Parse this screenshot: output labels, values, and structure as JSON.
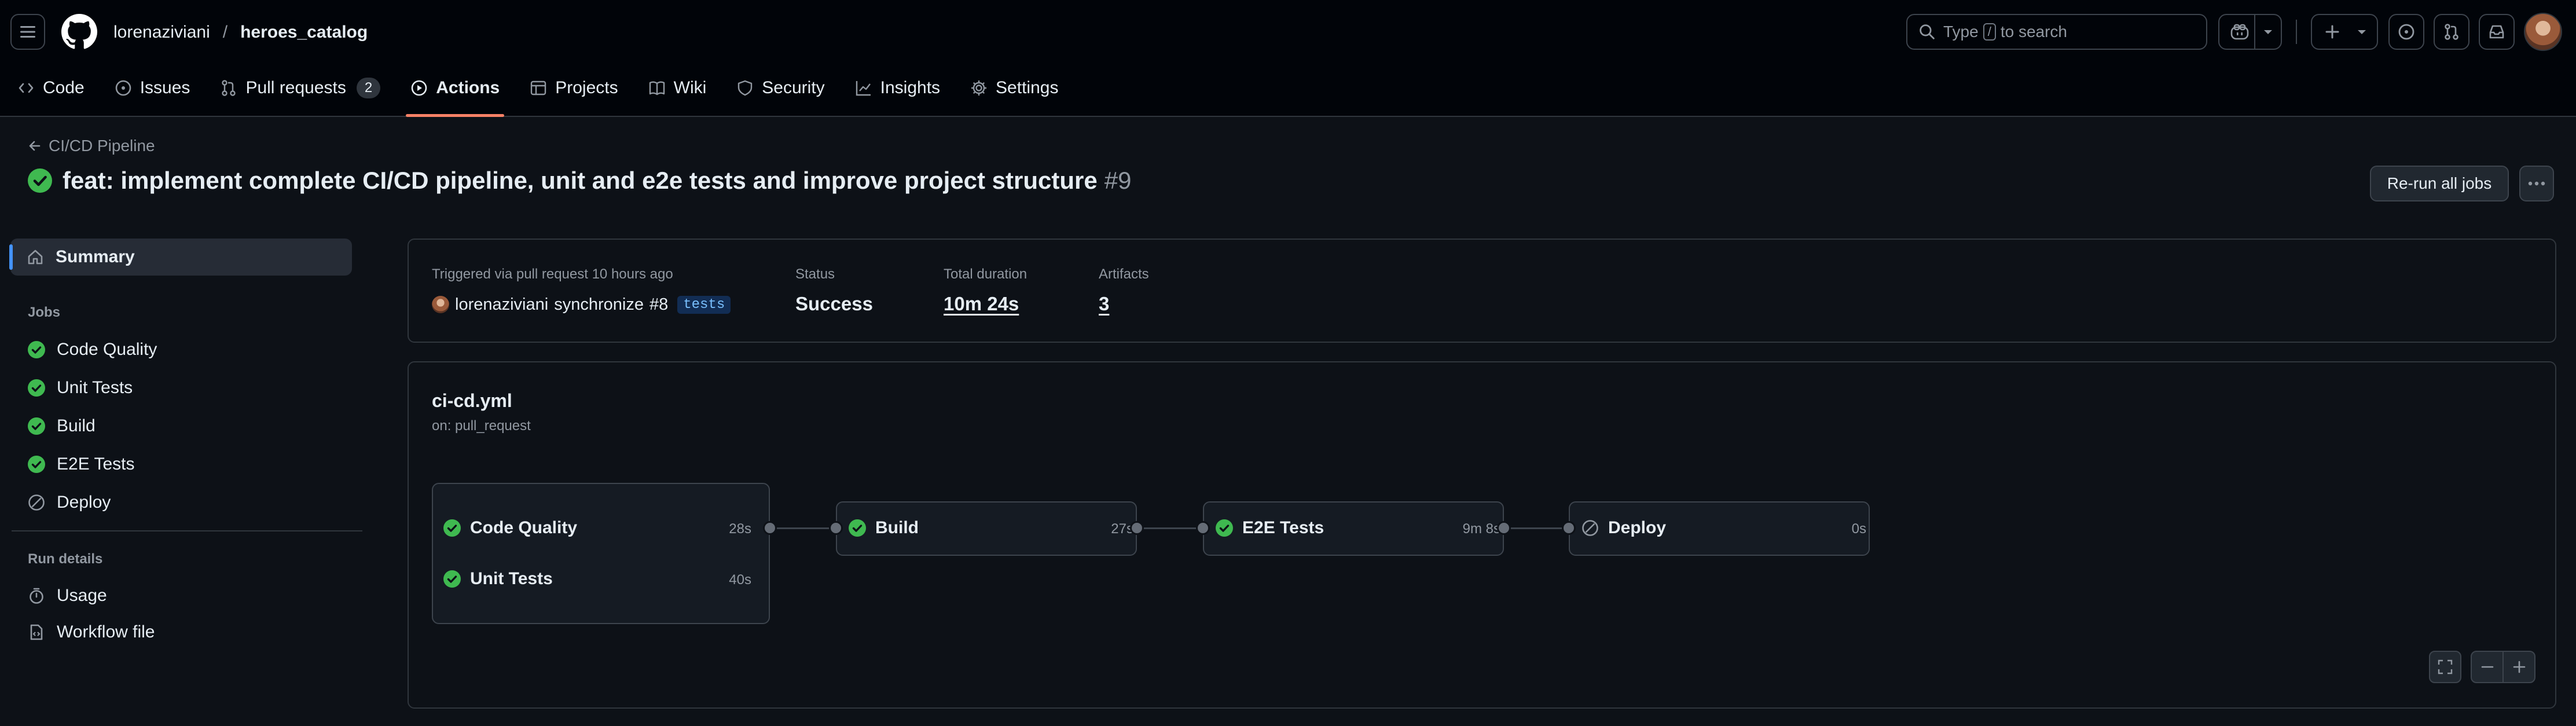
{
  "repo": {
    "owner": "lorenaziviani",
    "separator": "/",
    "name": "heroes_catalog"
  },
  "search": {
    "prefix": "Type",
    "key": "/",
    "suffix": "to search"
  },
  "nav_tabs": [
    {
      "label": "Code",
      "icon": "code-icon"
    },
    {
      "label": "Issues",
      "icon": "issue-icon"
    },
    {
      "label": "Pull requests",
      "icon": "pull-request-icon",
      "count": "2"
    },
    {
      "label": "Actions",
      "icon": "play-icon",
      "active": true
    },
    {
      "label": "Projects",
      "icon": "table-icon"
    },
    {
      "label": "Wiki",
      "icon": "book-icon"
    },
    {
      "label": "Security",
      "icon": "shield-icon"
    },
    {
      "label": "Insights",
      "icon": "graph-icon"
    },
    {
      "label": "Settings",
      "icon": "gear-icon"
    }
  ],
  "run": {
    "back_label": "CI/CD Pipeline",
    "title": "feat: implement complete CI/CD pipeline, unit and e2e tests and improve project structure",
    "number": "#9",
    "rerun_label": "Re-run all jobs",
    "more_label": "..."
  },
  "sidebar": {
    "summary_label": "Summary",
    "jobs_heading": "Jobs",
    "jobs": [
      {
        "label": "Code Quality",
        "status": "success"
      },
      {
        "label": "Unit Tests",
        "status": "success"
      },
      {
        "label": "Build",
        "status": "success"
      },
      {
        "label": "E2E Tests",
        "status": "success"
      },
      {
        "label": "Deploy",
        "status": "skipped"
      }
    ],
    "run_details_heading": "Run details",
    "usage_label": "Usage",
    "workflow_file_label": "Workflow file"
  },
  "summary": {
    "trigger_text": "Triggered via pull request 10 hours ago",
    "actor": "lorenaziviani",
    "action": "synchronize",
    "pr_ref": "#8",
    "branch": "tests",
    "status_label": "Status",
    "status_value": "Success",
    "duration_label": "Total duration",
    "duration_value": "10m 24s",
    "artifacts_label": "Artifacts",
    "artifacts_value": "3"
  },
  "workflow": {
    "file": "ci-cd.yml",
    "trigger": "on: pull_request",
    "jobs": [
      {
        "label": "Code Quality",
        "duration": "28s",
        "status": "success"
      },
      {
        "label": "Unit Tests",
        "duration": "40s",
        "status": "success"
      },
      {
        "label": "Build",
        "duration": "27s",
        "status": "success"
      },
      {
        "label": "E2E Tests",
        "duration": "9m 8s",
        "status": "success"
      },
      {
        "label": "Deploy",
        "duration": "0s",
        "status": "skipped"
      }
    ]
  },
  "colors": {
    "success": "#3fb950",
    "skipped": "#9198a1",
    "accent_underline": "#f78166",
    "background": "#0d1117",
    "header_bg": "#010409"
  }
}
